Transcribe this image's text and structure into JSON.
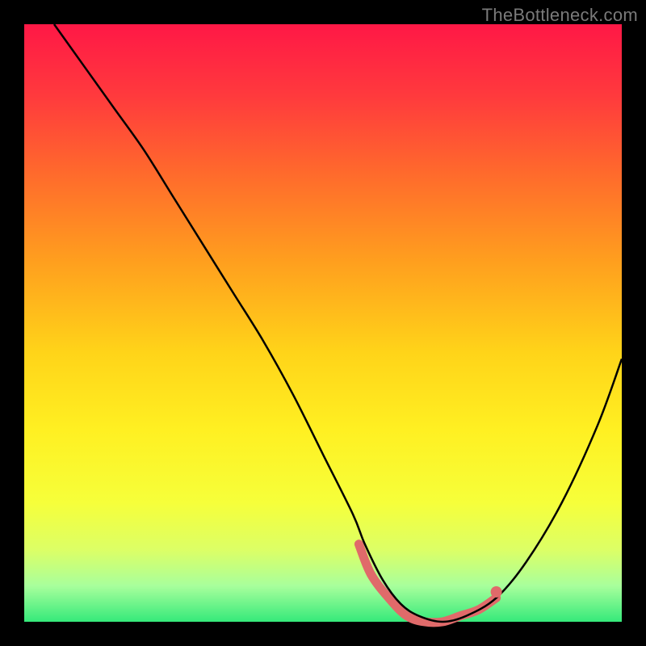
{
  "watermark": "TheBottleneck.com",
  "chart_data": {
    "type": "line",
    "title": "",
    "xlabel": "",
    "ylabel": "",
    "xlim": [
      0,
      100
    ],
    "ylim": [
      0,
      100
    ],
    "background": {
      "type": "vertical-gradient",
      "stops": [
        {
          "offset": 0.0,
          "color": "#ff1846"
        },
        {
          "offset": 0.12,
          "color": "#ff3a3d"
        },
        {
          "offset": 0.25,
          "color": "#ff6a2c"
        },
        {
          "offset": 0.4,
          "color": "#ffa01e"
        },
        {
          "offset": 0.55,
          "color": "#ffd419"
        },
        {
          "offset": 0.68,
          "color": "#fff022"
        },
        {
          "offset": 0.8,
          "color": "#f6ff3a"
        },
        {
          "offset": 0.88,
          "color": "#dcff66"
        },
        {
          "offset": 0.94,
          "color": "#a8ff9c"
        },
        {
          "offset": 1.0,
          "color": "#35e97a"
        }
      ]
    },
    "series": [
      {
        "name": "curve",
        "color": "#000000",
        "width": 2.5,
        "x": [
          5,
          10,
          15,
          20,
          25,
          30,
          35,
          40,
          45,
          50,
          55,
          57,
          60,
          63,
          66,
          70,
          74,
          79,
          84,
          90,
          96,
          100
        ],
        "y": [
          100,
          93,
          86,
          79,
          71,
          63,
          55,
          47,
          38,
          28,
          18,
          13,
          7,
          3,
          1,
          0,
          1,
          4,
          10,
          20,
          33,
          44
        ]
      },
      {
        "name": "highlight-band",
        "color": "#e06a6a",
        "width": 11,
        "linecap": "round",
        "x": [
          56,
          58,
          61,
          64,
          67,
          70,
          73,
          76,
          79
        ],
        "y": [
          13,
          8,
          4,
          1,
          0,
          0,
          1,
          2,
          4
        ]
      },
      {
        "name": "highlight-dot",
        "type": "scatter",
        "color": "#e06a6a",
        "radius": 7,
        "x": [
          79
        ],
        "y": [
          5
        ]
      }
    ]
  }
}
